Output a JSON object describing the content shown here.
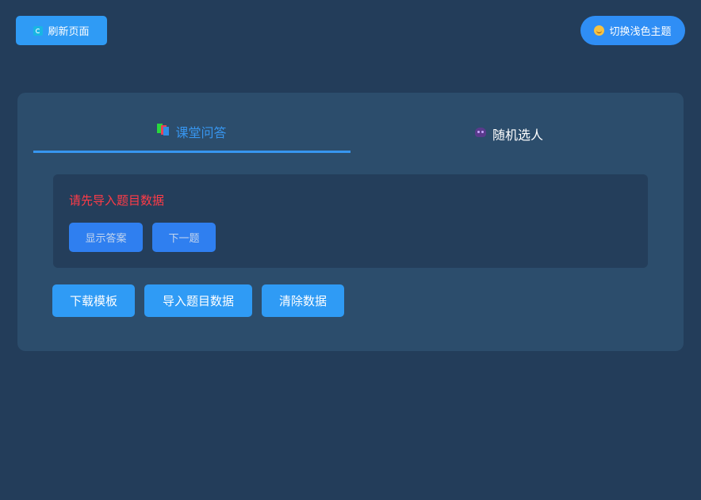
{
  "header": {
    "refresh_label": "刷新页面",
    "refresh_icon": "refresh-icon",
    "theme_label": "切换浅色主题",
    "theme_icon": "smile-icon"
  },
  "tabs": [
    {
      "label": "课堂问答",
      "icon": "books-icon",
      "active": true
    },
    {
      "label": "随机选人",
      "icon": "alien-icon",
      "active": false
    }
  ],
  "question_panel": {
    "message": "请先导入题目数据",
    "show_answer_label": "显示答案",
    "next_label": "下一题"
  },
  "actions": {
    "download_label": "下载模板",
    "import_label": "导入题目数据",
    "clear_label": "清除数据"
  },
  "colors": {
    "background": "#233d5a",
    "card": "#2c4d6c",
    "panel": "#243e5b",
    "accent": "#2f9bf5",
    "active_tab": "#3796f0",
    "error_text": "#ff3b47"
  }
}
